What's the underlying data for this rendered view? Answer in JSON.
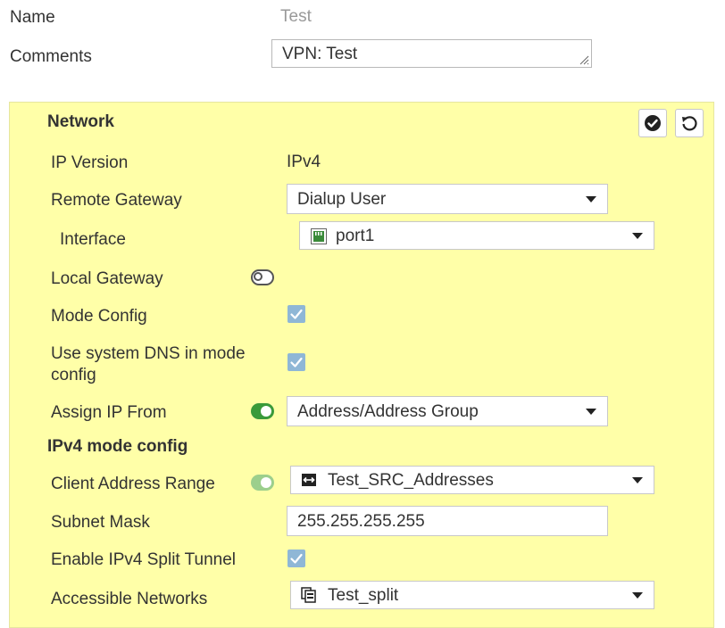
{
  "form": {
    "name_label": "Name",
    "name_value": "Test",
    "comments_label": "Comments",
    "comments_value": "VPN: Test"
  },
  "network": {
    "title": "Network",
    "ip_version_label": "IP Version",
    "ip_version_value": "IPv4",
    "remote_gateway_label": "Remote Gateway",
    "remote_gateway_value": "Dialup User",
    "interface_label": "Interface",
    "interface_value": "port1",
    "local_gateway_label": "Local Gateway",
    "local_gateway_enabled": false,
    "mode_config_label": "Mode Config",
    "mode_config_checked": true,
    "system_dns_label_line1": "Use system DNS in mode",
    "system_dns_label_line2": "config",
    "system_dns_checked": true,
    "assign_ip_label": "Assign IP From",
    "assign_ip_enabled": true,
    "assign_ip_value": "Address/Address Group"
  },
  "ipv4_mode_config": {
    "title": "IPv4 mode config",
    "client_range_label": "Client Address Range",
    "client_range_value": "Test_SRC_Addresses",
    "subnet_mask_label": "Subnet Mask",
    "subnet_mask_value": "255.255.255.255",
    "split_tunnel_label": "Enable IPv4 Split Tunnel",
    "split_tunnel_checked": true,
    "accessible_networks_label": "Accessible Networks",
    "accessible_networks_value": "Test_split"
  },
  "colors": {
    "panel_bg": "#ffffa8",
    "toggle_on": "#3a9a3a",
    "checkbox": "#8fb7d6"
  }
}
